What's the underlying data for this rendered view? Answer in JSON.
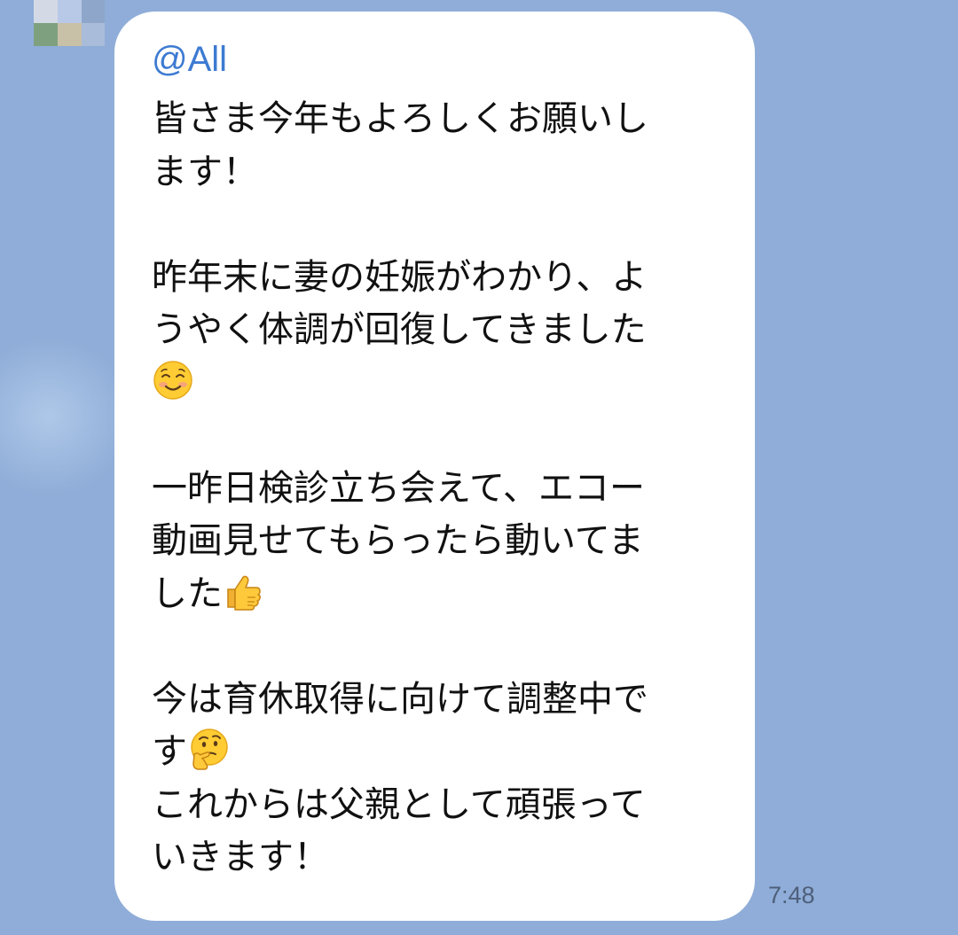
{
  "chat": {
    "background_color": "#8fadd8",
    "bubble_color": "#ffffff",
    "mention_color": "#3d7bd2"
  },
  "avatar": {
    "description_icon": "blurred-avatar-icon",
    "pixels": [
      "#7fa07f",
      "#b7c9e6",
      "#8ea6c9",
      "#c9c0a8",
      "#a9bcd9",
      "#d4d9e6"
    ]
  },
  "message": {
    "mention": "@All",
    "paragraphs": [
      [
        "皆さま今年もよろしくお願いし",
        "ます！"
      ],
      [
        "昨年末に妻の妊娠がわかり、よ",
        "うやく体調が回復してきました"
      ],
      [
        "一昨日検診立ち会えて、エコー",
        "動画見せてもらったら動いてま",
        "した"
      ],
      [
        "今は育休取得に向けて調整中で",
        "す",
        "これからは父親として頑張って",
        "いきます！"
      ]
    ],
    "emojis": {
      "smiling_face": "smiling-face-emoji",
      "thumbs_up": "thumbs-up-emoji",
      "thinking_face": "thinking-face-emoji"
    },
    "time": "7:48"
  }
}
